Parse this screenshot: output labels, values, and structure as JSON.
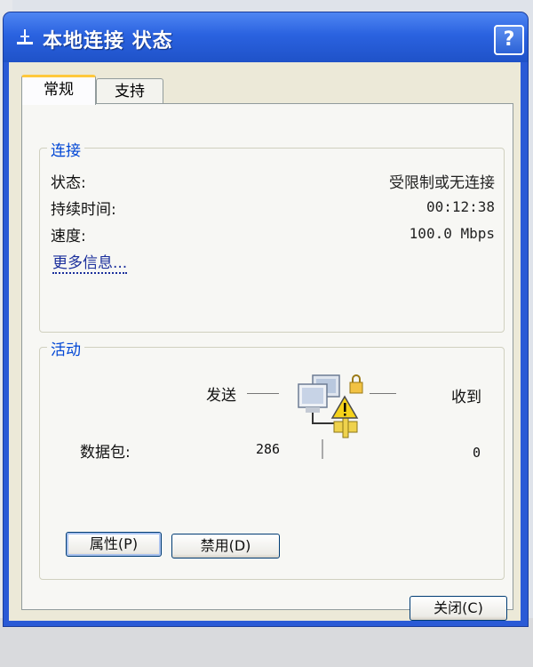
{
  "window": {
    "title": "本地连接 状态",
    "help_label": "?"
  },
  "tabs": [
    {
      "label": "常规",
      "active": true
    },
    {
      "label": "支持",
      "active": false
    }
  ],
  "connection": {
    "legend": "连接",
    "status_label": "状态:",
    "status_value": "受限制或无连接",
    "duration_label": "持续时间:",
    "duration_value": "00:12:38",
    "speed_label": "速度:",
    "speed_value": "100.0 Mbps",
    "more_info_link": "更多信息..."
  },
  "activity": {
    "legend": "活动",
    "sent_label": "发送",
    "received_label": "收到",
    "packets_label": "数据包:",
    "packets_sent": "286",
    "packets_received": "0"
  },
  "buttons": {
    "properties": "属性(P)",
    "disable": "禁用(D)",
    "close": "关闭(C)"
  },
  "colors": {
    "titlebar": "#2a62e0",
    "legend_text": "#0046d5",
    "link": "#1b2f9c",
    "dialog_bg": "#ece9d8"
  },
  "icons": {
    "title": "network-connection-icon",
    "activity": "network-limited-warning-icon"
  }
}
